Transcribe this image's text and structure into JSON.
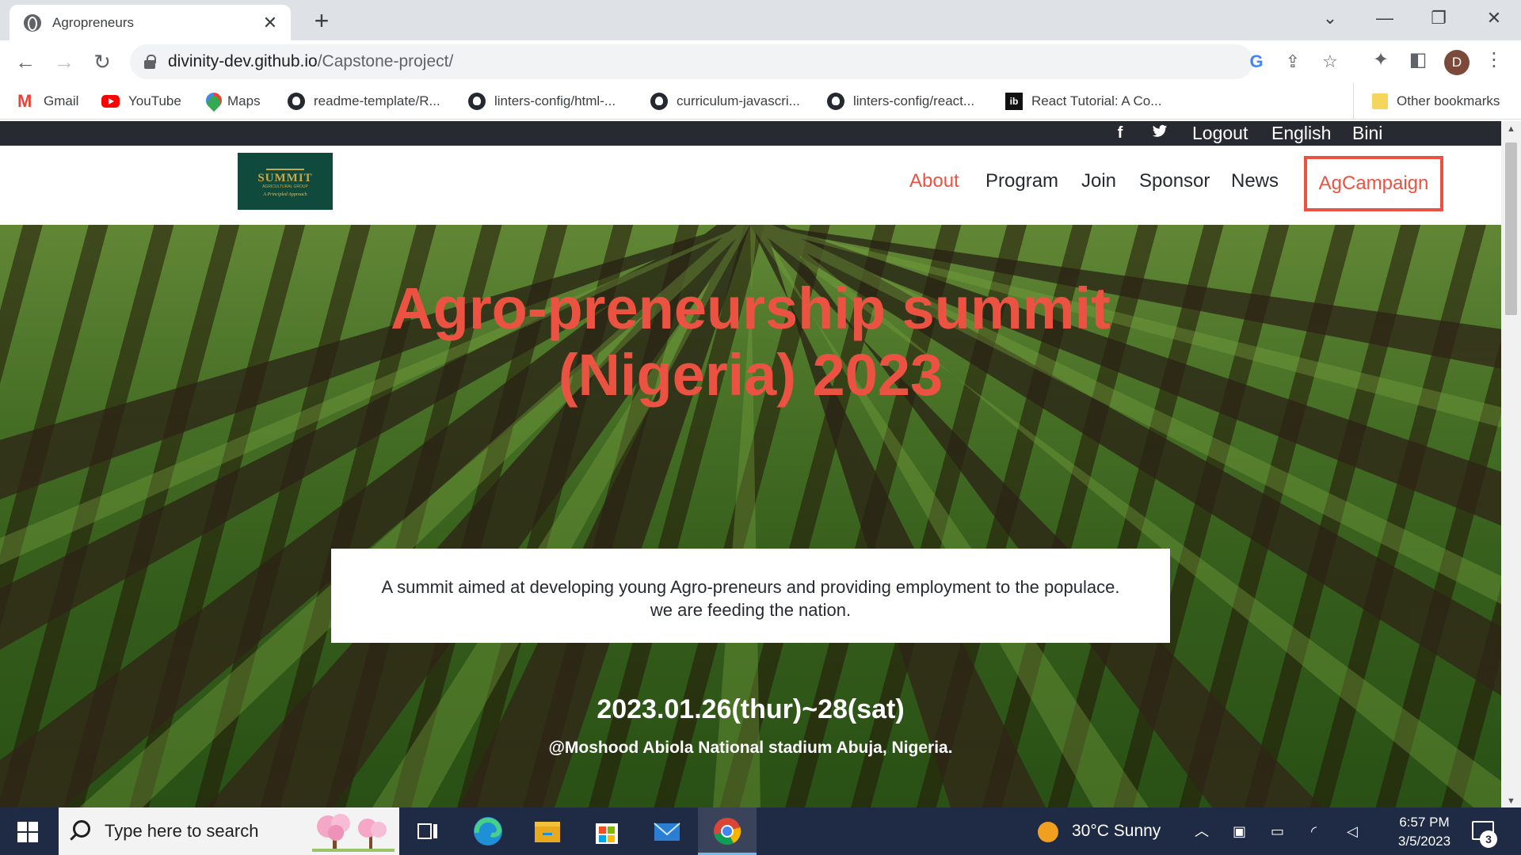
{
  "browser": {
    "tab_title": "Agropreneurs",
    "tab_close": "✕",
    "new_tab": "+",
    "url_host": "divinity-dev.github.io",
    "url_path": "/Capstone-project/",
    "profile_initial": "D",
    "bookmarks": [
      {
        "label": "Gmail",
        "icon": "gmail-icon"
      },
      {
        "label": "YouTube",
        "icon": "youtube-icon"
      },
      {
        "label": "Maps",
        "icon": "maps-icon"
      },
      {
        "label": "readme-template/R...",
        "icon": "github-icon"
      },
      {
        "label": "linters-config/html-...",
        "icon": "github-icon"
      },
      {
        "label": "curriculum-javascri...",
        "icon": "github-icon"
      },
      {
        "label": "linters-config/react...",
        "icon": "github-icon"
      },
      {
        "label": "React Tutorial: A Co...",
        "icon": "ib-icon"
      }
    ],
    "other_bookmarks": "Other bookmarks",
    "ib_text": "ib"
  },
  "site": {
    "topbar": {
      "facebook": "f",
      "logout": "Logout",
      "language": "English",
      "user": "Bini"
    },
    "logo": {
      "title": "SUMMIT",
      "subtitle": "AGRICULTURAL GROUP",
      "tagline": "A Principled Approach"
    },
    "nav": {
      "about": "About",
      "program": "Program",
      "join": "Join",
      "sponsor": "Sponsor",
      "news": "News",
      "campaign": "AgCampaign"
    },
    "hero": {
      "title_line1": "Agro-preneurship summit",
      "title_line2": "(Nigeria) 2023",
      "description_line1": "A summit aimed at developing young Agro-preneurs and providing employment to the populace.",
      "description_line2": "we are feeding the nation.",
      "date": "2023.01.26(thur)~28(sat)",
      "venue": "@Moshood Abiola National stadium Abuja, Nigeria."
    }
  },
  "taskbar": {
    "search_placeholder": "Type here to search",
    "weather": "30°C  Sunny",
    "time": "6:57 PM",
    "date": "3/5/2023",
    "notification_count": "3"
  },
  "colors": {
    "accent": "#ec5242",
    "dark": "#272a31",
    "taskbar": "#1f2a44"
  }
}
